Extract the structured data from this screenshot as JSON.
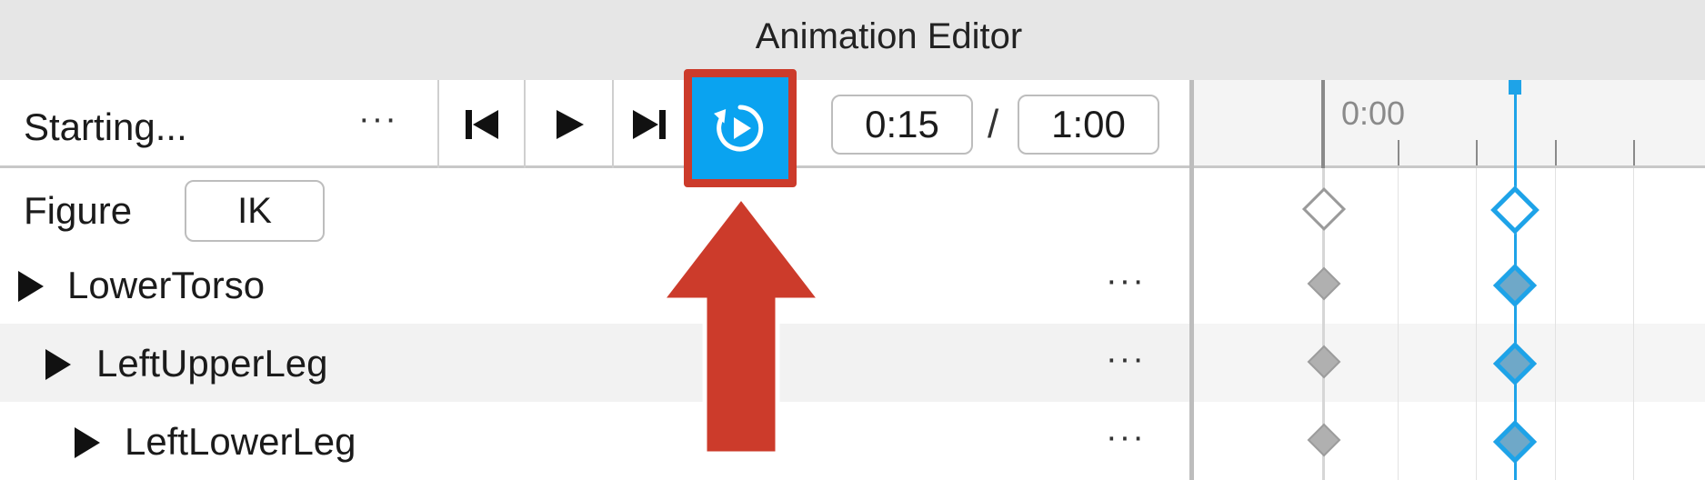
{
  "window": {
    "title": "Animation Editor"
  },
  "toolbar": {
    "animation_name": "Starting...",
    "menu_ellipsis": "···",
    "buttons": [
      {
        "name": "skip-to-start",
        "icon": "skip-back-icon"
      },
      {
        "name": "play",
        "icon": "play-icon"
      },
      {
        "name": "skip-to-end",
        "icon": "skip-forward-icon"
      },
      {
        "name": "loop",
        "icon": "loop-icon",
        "active": true,
        "highlight_color": "#cc3b2b",
        "active_color": "#0aa3f0"
      }
    ],
    "current_time": "0:15",
    "separator": "/",
    "total_time": "1:00"
  },
  "tracks": {
    "figure_label": "Figure",
    "ik_button": "IK",
    "rows": [
      {
        "label": "LowerTorso",
        "ellipsis": "···"
      },
      {
        "label": "LeftUpperLeg",
        "ellipsis": "···"
      },
      {
        "label": "LeftLowerLeg",
        "ellipsis": "···"
      }
    ]
  },
  "timeline": {
    "start_label": "0:00",
    "scrubber_color": "#1ea3e8",
    "keyframe_color": "#b0b0b0"
  },
  "annotation": {
    "arrow_color": "#cc3b2b"
  }
}
